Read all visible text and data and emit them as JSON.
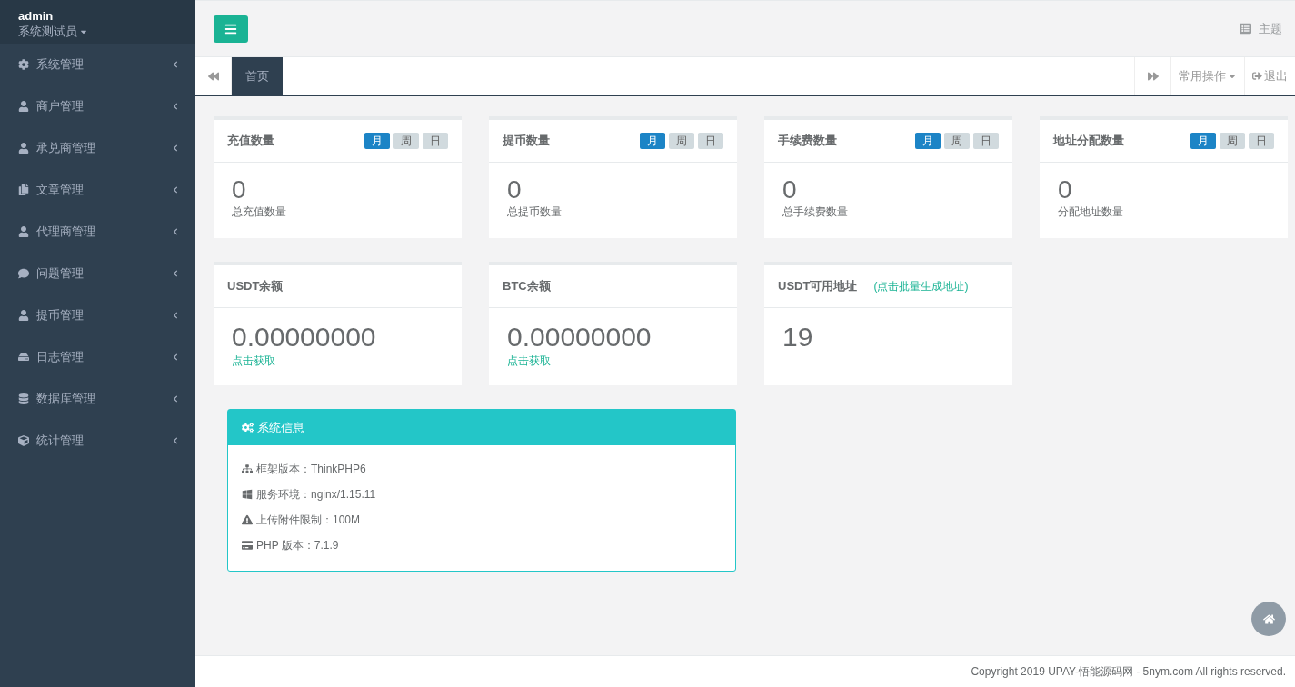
{
  "user": {
    "name": "admin",
    "role": "系统测试员"
  },
  "sidebar": {
    "items": [
      {
        "label": "系统管理"
      },
      {
        "label": "商户管理"
      },
      {
        "label": "承兑商管理"
      },
      {
        "label": "文章管理"
      },
      {
        "label": "代理商管理"
      },
      {
        "label": "问题管理"
      },
      {
        "label": "提币管理"
      },
      {
        "label": "日志管理"
      },
      {
        "label": "数据库管理"
      },
      {
        "label": "统计管理"
      }
    ]
  },
  "header": {
    "theme_label": "主题"
  },
  "tabs": [
    {
      "label": "首页",
      "selected": true
    }
  ],
  "tab_actions": {
    "menu": "常用操作",
    "logout": "退出"
  },
  "stat_cards": [
    {
      "title": "充值数量",
      "ranges": [
        {
          "label": "月",
          "selected": true
        },
        {
          "label": "周",
          "selected": false
        },
        {
          "label": "日",
          "selected": false
        }
      ],
      "value": "0",
      "caption": "总充值数量"
    },
    {
      "title": "提币数量",
      "ranges": [
        {
          "label": "月",
          "selected": true
        },
        {
          "label": "周",
          "selected": false
        },
        {
          "label": "日",
          "selected": false
        }
      ],
      "value": "0",
      "caption": "总提币数量"
    },
    {
      "title": "手续费数量",
      "ranges": [
        {
          "label": "月",
          "selected": true
        },
        {
          "label": "周",
          "selected": false
        },
        {
          "label": "日",
          "selected": false
        }
      ],
      "value": "0",
      "caption": "总手续费数量"
    },
    {
      "title": "地址分配数量",
      "ranges": [
        {
          "label": "月",
          "selected": true
        },
        {
          "label": "周",
          "selected": false
        },
        {
          "label": "日",
          "selected": false
        }
      ],
      "value": "0",
      "caption": "分配地址数量"
    }
  ],
  "balance_cards": [
    {
      "kind": "balance",
      "title": "USDT余额",
      "value": "0.00000000",
      "link": "点击获取"
    },
    {
      "kind": "balance",
      "title": "BTC余额",
      "value": "0.00000000",
      "link": "点击获取"
    },
    {
      "kind": "address",
      "title": "USDT可用地址",
      "link": "(点击批量生成地址)",
      "value": "19"
    }
  ],
  "system_info": {
    "title": "系统信息",
    "rows": [
      "框架版本：ThinkPHP6",
      "服务环境：nginx/1.15.11",
      "上传附件限制：100M",
      "PHP 版本：7.1.9"
    ]
  },
  "footer": "Copyright 2019 UPAY-悟能源码网 - 5nym.com All rights reserved."
}
